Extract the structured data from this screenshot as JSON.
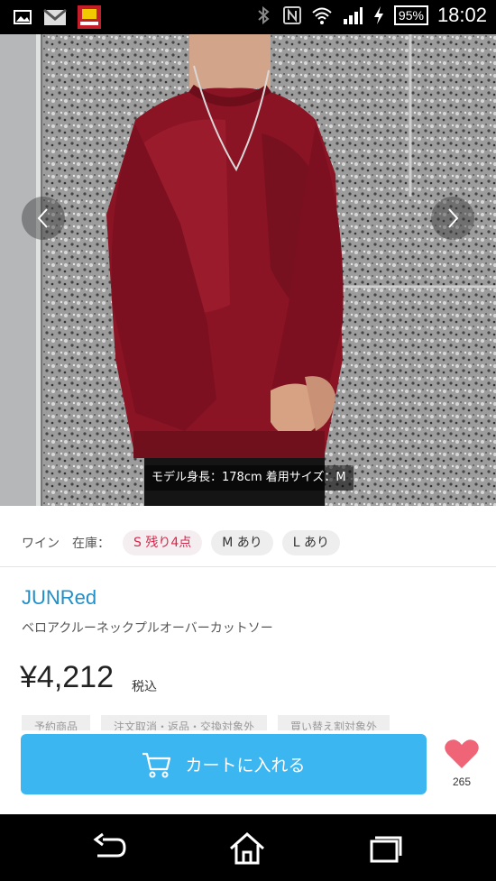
{
  "status_bar": {
    "time": "18:02",
    "battery": "95%",
    "icons": [
      "image-icon",
      "gmail-icon",
      "app-notification-icon",
      "bluetooth-icon",
      "nfc-icon",
      "wifi-icon",
      "signal-icon",
      "charging-icon"
    ]
  },
  "hero": {
    "caption": "モデル身長：178cm 着用サイズ：M",
    "prev_icon": "chevron-left-icon",
    "next_icon": "chevron-right-icon"
  },
  "variant": {
    "color": "ワイン",
    "stock_label": "在庫：",
    "sizes": [
      {
        "label": "S 残り4点",
        "status": "low"
      },
      {
        "label": "M あり",
        "status": "in-stock"
      },
      {
        "label": "L あり",
        "status": "in-stock"
      }
    ]
  },
  "product": {
    "brand": "JUNRed",
    "name": "ベロアクルーネックプルオーバーカットソー",
    "price": "¥4,212",
    "tax_note": "税込",
    "tags": [
      "予約商品",
      "注文取消・返品・交換対象外",
      "買い替え割対象外"
    ]
  },
  "cart": {
    "button_label": "カートに入れる",
    "favorite_count": "265"
  },
  "colors": {
    "brand_blue": "#1f8fc9",
    "cart_button": "#3cb6f0",
    "low_stock": "#d8264a",
    "heart": "#f06478",
    "sweater": "#8b1424"
  },
  "nav_bar": {
    "icons": [
      "back-icon",
      "home-icon",
      "recent-apps-icon"
    ]
  }
}
